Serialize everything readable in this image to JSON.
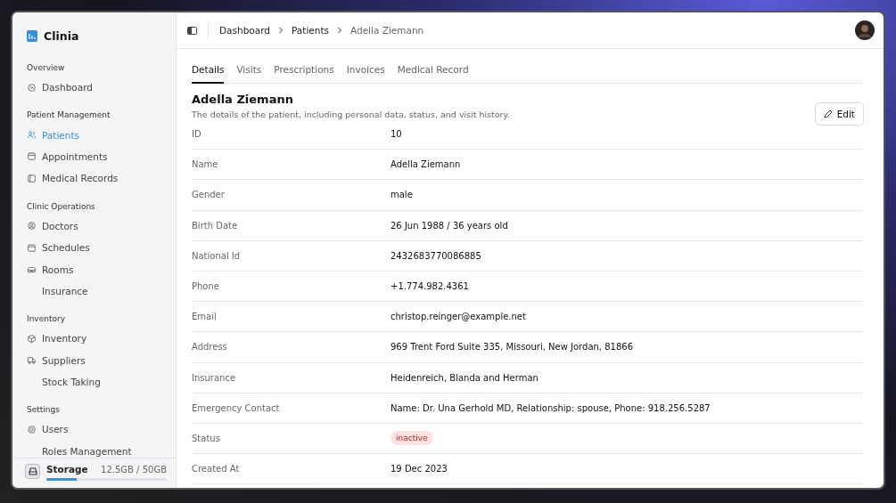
{
  "brand": {
    "name": "Clinia"
  },
  "sidebar": {
    "sections": [
      {
        "title": "Overview",
        "items": [
          {
            "label": "Dashboard",
            "has_icon": true,
            "selected": false
          }
        ]
      },
      {
        "title": "Patient Management",
        "items": [
          {
            "label": "Patients",
            "has_icon": true,
            "selected": true
          },
          {
            "label": "Appointments",
            "has_icon": true,
            "selected": false
          },
          {
            "label": "Medical Records",
            "has_icon": true,
            "selected": false
          }
        ]
      },
      {
        "title": "Clinic Operations",
        "items": [
          {
            "label": "Doctors",
            "has_icon": true,
            "selected": false
          },
          {
            "label": "Schedules",
            "has_icon": true,
            "selected": false
          },
          {
            "label": "Rooms",
            "has_icon": true,
            "selected": false
          },
          {
            "label": "Insurance",
            "has_icon": false,
            "selected": false
          }
        ]
      },
      {
        "title": "Inventory",
        "items": [
          {
            "label": "Inventory",
            "has_icon": true,
            "selected": false
          },
          {
            "label": "Suppliers",
            "has_icon": true,
            "selected": false
          },
          {
            "label": "Stock Taking",
            "has_icon": false,
            "selected": false
          }
        ]
      },
      {
        "title": "Settings",
        "items": [
          {
            "label": "Users",
            "has_icon": true,
            "selected": false
          },
          {
            "label": "Roles Management",
            "has_icon": false,
            "selected": false
          }
        ]
      }
    ],
    "storage": {
      "label": "Storage",
      "usage": "12.5GB / 50GB",
      "level": 0.25
    }
  },
  "breadcrumb": [
    {
      "label": "Dashboard",
      "current": false
    },
    {
      "label": "Patients",
      "current": false
    },
    {
      "label": "Adella Ziemann",
      "current": true
    }
  ],
  "tabs": [
    {
      "label": "Details",
      "selected": true
    },
    {
      "label": "Visits",
      "selected": false
    },
    {
      "label": "Prescriptions",
      "selected": false
    },
    {
      "label": "Invoices",
      "selected": false
    },
    {
      "label": "Medical Record",
      "selected": false
    }
  ],
  "details": {
    "title": "Adella Ziemann",
    "subtitle": "The details of the patient, including personal data, status, and visit history.",
    "edit_button": "Edit",
    "rows": [
      {
        "label": "ID",
        "value": "10",
        "kind": "text"
      },
      {
        "label": "Name",
        "value": "Adella Ziemann",
        "kind": "text"
      },
      {
        "label": "Gender",
        "value": "male",
        "kind": "text"
      },
      {
        "label": "Birth Date",
        "value": "26 Jun 1988 / 36 years old",
        "kind": "text"
      },
      {
        "label": "National Id",
        "value": "2432683770086885",
        "kind": "text"
      },
      {
        "label": "Phone",
        "value": "+1.774.982.4361",
        "kind": "text"
      },
      {
        "label": "Email",
        "value": "christop.reinger@example.net",
        "kind": "text"
      },
      {
        "label": "Address",
        "value": "969 Trent Ford Suite 335, Missouri, New Jordan, 81866",
        "kind": "text"
      },
      {
        "label": "Insurance",
        "value": "Heidenreich, Blanda and Herman",
        "kind": "text"
      },
      {
        "label": "Emergency Contact",
        "value": "Name: Dr. Una Gerhold MD, Relationship: spouse, Phone: 918.256.5287",
        "kind": "text"
      },
      {
        "label": "Status",
        "value": "inactive",
        "kind": "badge"
      },
      {
        "label": "Created At",
        "value": "19 Dec 2023",
        "kind": "text"
      }
    ]
  }
}
